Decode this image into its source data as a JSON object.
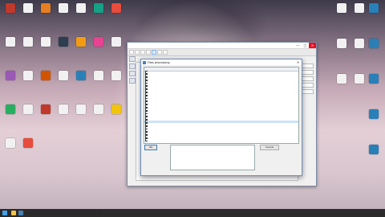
{
  "colors": {
    "accent": "#3c7fb1",
    "close_red": "#e81123",
    "selection": "#cce4f7"
  },
  "desktop": {
    "icons": [
      {
        "label": "",
        "color": "#c0392b"
      },
      {
        "label": "",
        "color": "#f1f1f1"
      },
      {
        "label": "",
        "color": "#e67e22"
      },
      {
        "label": "",
        "color": "#f1f1f1"
      },
      {
        "label": "",
        "color": "#f1f1f1"
      },
      {
        "label": "",
        "color": "#16a085"
      },
      {
        "label": "",
        "color": "#e74c3c"
      },
      {
        "label": "",
        "color": "#f1f1f1"
      },
      {
        "label": "",
        "color": "#f1f1f1"
      },
      {
        "label": "",
        "color": "#f1f1f1"
      },
      {
        "label": "",
        "color": "#2c3e50"
      },
      {
        "label": "",
        "color": "#f39c12"
      },
      {
        "label": "",
        "color": "#e84393"
      },
      {
        "label": "",
        "color": "#f1f1f1"
      },
      {
        "label": "",
        "color": "#9b59b6"
      },
      {
        "label": "",
        "color": "#f1f1f1"
      },
      {
        "label": "",
        "color": "#d35400"
      },
      {
        "label": "",
        "color": "#f1f1f1"
      },
      {
        "label": "",
        "color": "#2980b9"
      },
      {
        "label": "",
        "color": "#f1f1f1"
      },
      {
        "label": "",
        "color": "#f1f1f1"
      },
      {
        "label": "",
        "color": "#27ae60"
      },
      {
        "label": "",
        "color": "#f1f1f1"
      },
      {
        "label": "",
        "color": "#c0392b"
      },
      {
        "label": "",
        "color": "#f1f1f1"
      },
      {
        "label": "",
        "color": "#f1f1f1"
      },
      {
        "label": "",
        "color": "#f1f1f1"
      },
      {
        "label": "",
        "color": "#f1c40f"
      },
      {
        "label": "",
        "color": "#f1f1f1"
      },
      {
        "label": "",
        "color": "#e74c3c"
      }
    ]
  },
  "app": {
    "title": "",
    "toolbar": [
      "",
      "",
      "",
      "",
      "",
      "",
      ""
    ],
    "header": "",
    "status": ""
  },
  "dialog": {
    "title": "Files processing",
    "headers": [
      "",
      "",
      "",
      "",
      "",
      ""
    ],
    "rows": [
      [
        "",
        "",
        "",
        "",
        "",
        ""
      ],
      [
        "",
        "",
        "",
        "",
        "",
        ""
      ],
      [
        "",
        "",
        "",
        "",
        "",
        ""
      ],
      [
        "",
        "",
        "",
        "",
        "",
        ""
      ],
      [
        "",
        "",
        "",
        "",
        "",
        ""
      ],
      [
        "",
        "",
        "",
        "",
        "",
        ""
      ],
      [
        "",
        "",
        "",
        "",
        "",
        ""
      ],
      [
        "",
        "",
        "",
        "",
        "",
        ""
      ],
      [
        "",
        "",
        "",
        "",
        "",
        ""
      ],
      [
        "",
        "",
        "",
        "",
        "",
        ""
      ],
      [
        "",
        "",
        "",
        "",
        "",
        ""
      ],
      [
        "",
        "",
        "",
        "",
        "",
        ""
      ],
      [
        "",
        "",
        "",
        "",
        "",
        ""
      ],
      [
        "",
        "",
        "",
        "",
        "",
        ""
      ],
      [
        "",
        "",
        "",
        "",
        "",
        ""
      ],
      [
        "",
        "",
        "",
        "",
        "",
        ""
      ],
      [
        "",
        "",
        "",
        "",
        "",
        ""
      ],
      [
        "",
        "",
        "",
        "",
        "",
        ""
      ],
      [
        "",
        "",
        "",
        "",
        "",
        ""
      ],
      [
        "",
        "",
        "",
        "",
        "",
        ""
      ],
      [
        "",
        "",
        "",
        "",
        "",
        ""
      ],
      [
        "",
        "",
        "",
        "",
        "",
        ""
      ],
      [
        "",
        "",
        "",
        "",
        "",
        ""
      ]
    ],
    "ok_label": "OK",
    "cancel_label": "Cancel"
  }
}
